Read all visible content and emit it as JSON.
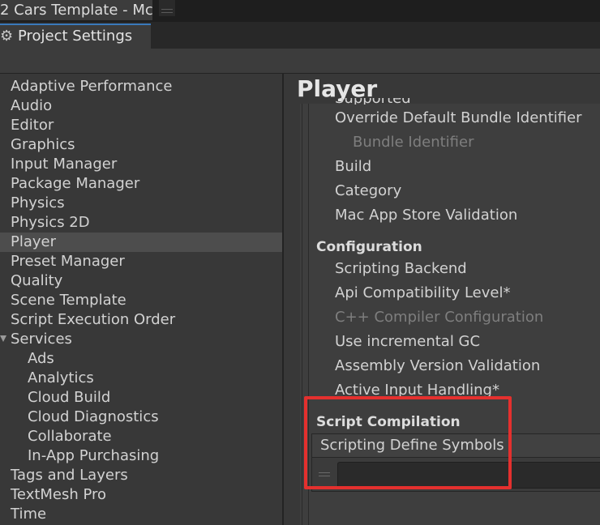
{
  "window": {
    "title": "2 Cars Template - Mc"
  },
  "settings_tab": {
    "icon": "gear-icon",
    "label": "Project Settings"
  },
  "sidebar": {
    "items": [
      {
        "label": "Adaptive Performance"
      },
      {
        "label": "Audio"
      },
      {
        "label": "Editor"
      },
      {
        "label": "Graphics"
      },
      {
        "label": "Input Manager"
      },
      {
        "label": "Package Manager"
      },
      {
        "label": "Physics"
      },
      {
        "label": "Physics 2D"
      },
      {
        "label": "Player",
        "selected": true
      },
      {
        "label": "Preset Manager"
      },
      {
        "label": "Quality"
      },
      {
        "label": "Scene Template"
      },
      {
        "label": "Script Execution Order"
      },
      {
        "label": "Services",
        "expanded": true
      },
      {
        "label": "Ads",
        "child": true
      },
      {
        "label": "Analytics",
        "child": true
      },
      {
        "label": "Cloud Build",
        "child": true
      },
      {
        "label": "Cloud Diagnostics",
        "child": true
      },
      {
        "label": "Collaborate",
        "child": true
      },
      {
        "label": "In-App Purchasing",
        "child": true
      },
      {
        "label": "Tags and Layers"
      },
      {
        "label": "TextMesh Pro"
      },
      {
        "label": "Time"
      }
    ]
  },
  "main": {
    "title": "Player",
    "cut_off_label": "Supported URL schemes",
    "identification_items": [
      {
        "label": "Override Default Bundle Identifier"
      },
      {
        "label": "Bundle Identifier",
        "disabled": true
      },
      {
        "label": "Build"
      },
      {
        "label": "Category"
      },
      {
        "label": "Mac App Store Validation"
      }
    ],
    "configuration": {
      "header": "Configuration",
      "items": [
        {
          "label": "Scripting Backend"
        },
        {
          "label": "Api Compatibility Level*"
        },
        {
          "label": "C++ Compiler Configuration",
          "disabled": true
        },
        {
          "label": "Use incremental GC"
        },
        {
          "label": "Assembly Version Validation"
        },
        {
          "label": "Active Input Handling*"
        }
      ]
    },
    "script_compilation": {
      "header": "Script Compilation",
      "defines_label": "Scripting Define Symbols",
      "define_value": ""
    }
  },
  "colors": {
    "highlight": "#e4302e",
    "selected_row": "#4d4d4d",
    "tab_accent": "#3a79bb"
  }
}
